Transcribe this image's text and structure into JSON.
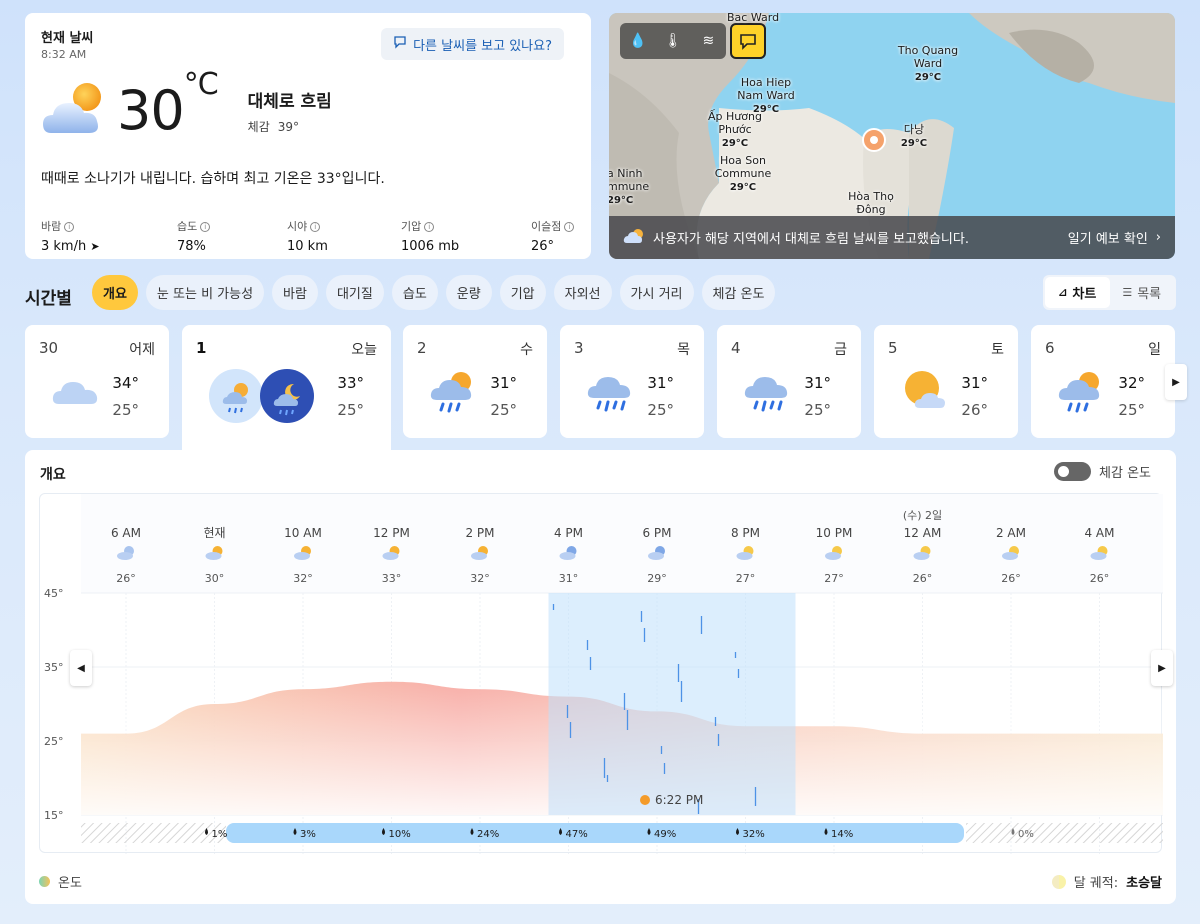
{
  "current": {
    "title": "현재 날씨",
    "time": "8:32 AM",
    "report_button": "다른 날씨를 보고 있나요?",
    "temp": "30",
    "unit": "°C",
    "condition": "대체로 흐림",
    "feels_label": "체감",
    "feels_value": "39°",
    "summary": "때때로 소나기가 내립니다. 습하며 최고 기온은 33°입니다.",
    "stats": [
      {
        "label": "바람",
        "value": "3 km/h"
      },
      {
        "label": "습도",
        "value": "78%"
      },
      {
        "label": "시야",
        "value": "10 km"
      },
      {
        "label": "기압",
        "value": "1006 mb"
      },
      {
        "label": "이슬점",
        "value": "26°"
      }
    ]
  },
  "map": {
    "labels": [
      {
        "name": "Bac Ward",
        "temp": ""
      },
      {
        "name": "Tho Quang Ward",
        "temp": "29°C"
      },
      {
        "name": "Hoa Hiep Nam Ward",
        "temp": "29°C"
      },
      {
        "name": "Ấp Hương Phước",
        "temp": "29°C"
      },
      {
        "name": "다낭",
        "temp": "29°C"
      },
      {
        "name": "Hoa Son Commune",
        "temp": "29°C"
      },
      {
        "name": "a Ninh mmune",
        "temp": "29°C"
      },
      {
        "name": "Hòa Thọ Đông",
        "temp": ""
      }
    ],
    "banner_text": "사용자가 해당 지역에서 대체로 흐림 날씨를 보고했습니다.",
    "banner_link": "일기 예보 확인"
  },
  "hourly": {
    "title": "시간별",
    "chips": [
      "개요",
      "눈 또는 비 가능성",
      "바람",
      "대기질",
      "습도",
      "운량",
      "기압",
      "자외선",
      "가시 거리",
      "체감 온도"
    ],
    "view_chart": "차트",
    "view_list": "목록"
  },
  "days": [
    {
      "num": "30",
      "name": "어제",
      "hi": "34°",
      "lo": "25°",
      "icon": "cloudy-icon"
    },
    {
      "num": "1",
      "name": "오늘",
      "hi": "33°",
      "lo": "25°",
      "icon": "rain-day-night-icon"
    },
    {
      "num": "2",
      "name": "수",
      "hi": "31°",
      "lo": "25°",
      "icon": "sun-rain-icon"
    },
    {
      "num": "3",
      "name": "목",
      "hi": "31°",
      "lo": "25°",
      "icon": "rain-icon"
    },
    {
      "num": "4",
      "name": "금",
      "hi": "31°",
      "lo": "25°",
      "icon": "rain-icon"
    },
    {
      "num": "5",
      "name": "토",
      "hi": "31°",
      "lo": "26°",
      "icon": "partly-sunny-icon"
    },
    {
      "num": "6",
      "name": "일",
      "hi": "32°",
      "lo": "25°",
      "icon": "sun-rain-icon"
    }
  ],
  "detail": {
    "title": "개요",
    "feels_toggle": "체감 온도",
    "legend_temp": "온도",
    "moon_label": "달 궤적:",
    "moon_phase": "초승달",
    "sunset_label": "6:22 PM",
    "date_marker": "(수) 2일"
  },
  "chart_data": {
    "type": "area",
    "hours": [
      "6 AM",
      "현재",
      "10 AM",
      "12 PM",
      "2 PM",
      "4 PM",
      "6 PM",
      "8 PM",
      "10 PM",
      "12 AM",
      "2 AM",
      "4 AM"
    ],
    "temps": [
      26,
      30,
      32,
      33,
      32,
      31,
      29,
      27,
      27,
      26,
      26,
      26
    ],
    "yticks": [
      "45°",
      "35°",
      "25°",
      "15°"
    ],
    "ylim": [
      15,
      45
    ],
    "precip": [
      "1%",
      "3%",
      "10%",
      "24%",
      "47%",
      "49%",
      "32%",
      "14%",
      "0%"
    ]
  }
}
